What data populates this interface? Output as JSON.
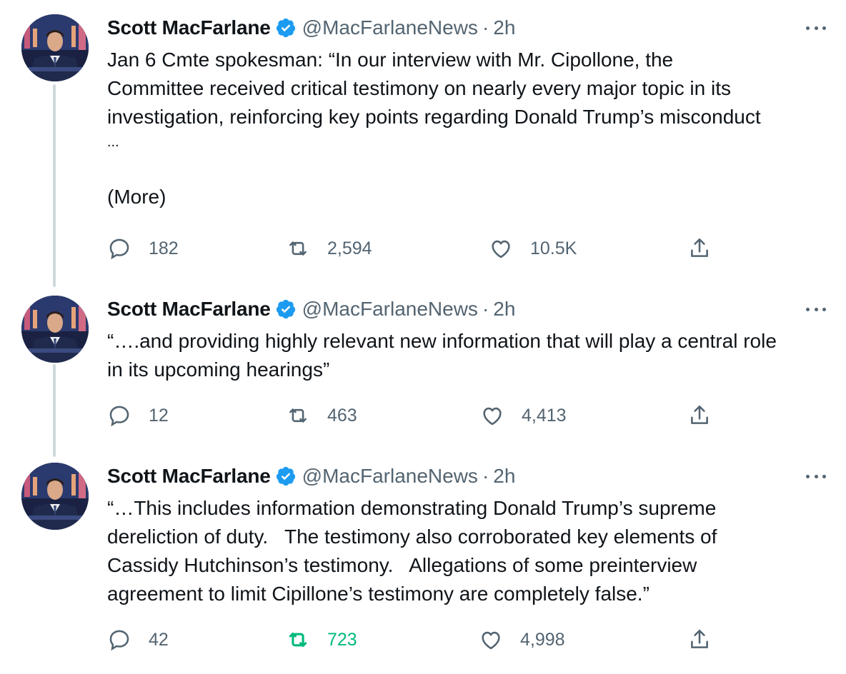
{
  "tweets": [
    {
      "author_name": "Scott MacFarlane",
      "handle": "@MacFarlaneNews",
      "separator": "·",
      "time": "2h",
      "text_lines": [
        "Jan 6 Cmte spokesman: “In our interview with Mr. Cipollone, the",
        "Committee received critical testimony on nearly every major topic in its",
        "investigation, reinforcing key points regarding Donald Trump’s misconduct",
        "..."
      ],
      "more_label": "(More)",
      "replies": "182",
      "retweets": "2,594",
      "likes": "10.5K",
      "retweeted": false
    },
    {
      "author_name": "Scott MacFarlane",
      "handle": "@MacFarlaneNews",
      "separator": "·",
      "time": "2h",
      "text_lines": [
        "“….and providing highly relevant new information that will play a central role",
        "in its upcoming hearings”"
      ],
      "replies": "12",
      "retweets": "463",
      "likes": "4,413",
      "retweeted": false
    },
    {
      "author_name": "Scott MacFarlane",
      "handle": "@MacFarlaneNews",
      "separator": "·",
      "time": "2h",
      "text_lines": [
        "“…This includes information demonstrating Donald Trump’s supreme",
        "dereliction of duty.   The testimony also corroborated key elements of",
        "Cassidy Hutchinson’s testimony.   Allegations of some preinterview",
        "agreement to limit Cipillone’s testimony are completely false.”"
      ],
      "replies": "42",
      "retweets": "723",
      "likes": "4,998",
      "retweeted": true
    }
  ],
  "icons": {
    "verified": "verified-badge-icon",
    "reply": "reply-icon",
    "retweet": "retweet-icon",
    "like": "heart-icon",
    "share": "share-icon",
    "more": "more-icon"
  },
  "colors": {
    "verified_blue": "#1d9bf0",
    "secondary_text": "#536471",
    "retweet_green": "#00ba7c",
    "thread_line": "#cfd9de"
  }
}
